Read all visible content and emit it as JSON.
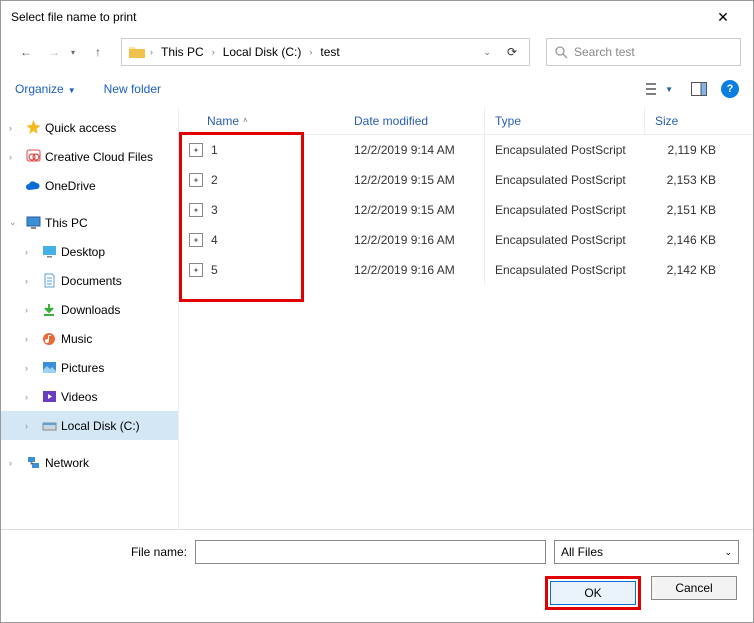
{
  "title": "Select file name to print",
  "breadcrumbs": [
    "This PC",
    "Local Disk (C:)",
    "test"
  ],
  "search_placeholder": "Search test",
  "toolbar": {
    "organize": "Organize",
    "newfolder": "New folder"
  },
  "sidebar": {
    "quick": "Quick access",
    "ccf": "Creative Cloud Files",
    "onedrive": "OneDrive",
    "thispc": "This PC",
    "desktop": "Desktop",
    "documents": "Documents",
    "downloads": "Downloads",
    "music": "Music",
    "pictures": "Pictures",
    "videos": "Videos",
    "localdisk": "Local Disk (C:)",
    "network": "Network"
  },
  "columns": {
    "name": "Name",
    "date": "Date modified",
    "type": "Type",
    "size": "Size"
  },
  "files": [
    {
      "name": "1",
      "date": "12/2/2019 9:14 AM",
      "type": "Encapsulated PostScript",
      "size": "2,119 KB"
    },
    {
      "name": "2",
      "date": "12/2/2019 9:15 AM",
      "type": "Encapsulated PostScript",
      "size": "2,153 KB"
    },
    {
      "name": "3",
      "date": "12/2/2019 9:15 AM",
      "type": "Encapsulated PostScript",
      "size": "2,151 KB"
    },
    {
      "name": "4",
      "date": "12/2/2019 9:16 AM",
      "type": "Encapsulated PostScript",
      "size": "2,146 KB"
    },
    {
      "name": "5",
      "date": "12/2/2019 9:16 AM",
      "type": "Encapsulated PostScript",
      "size": "2,142 KB"
    }
  ],
  "footer": {
    "filename_label": "File name:",
    "filename_value": "",
    "filter": "All Files",
    "ok": "OK",
    "cancel": "Cancel"
  }
}
